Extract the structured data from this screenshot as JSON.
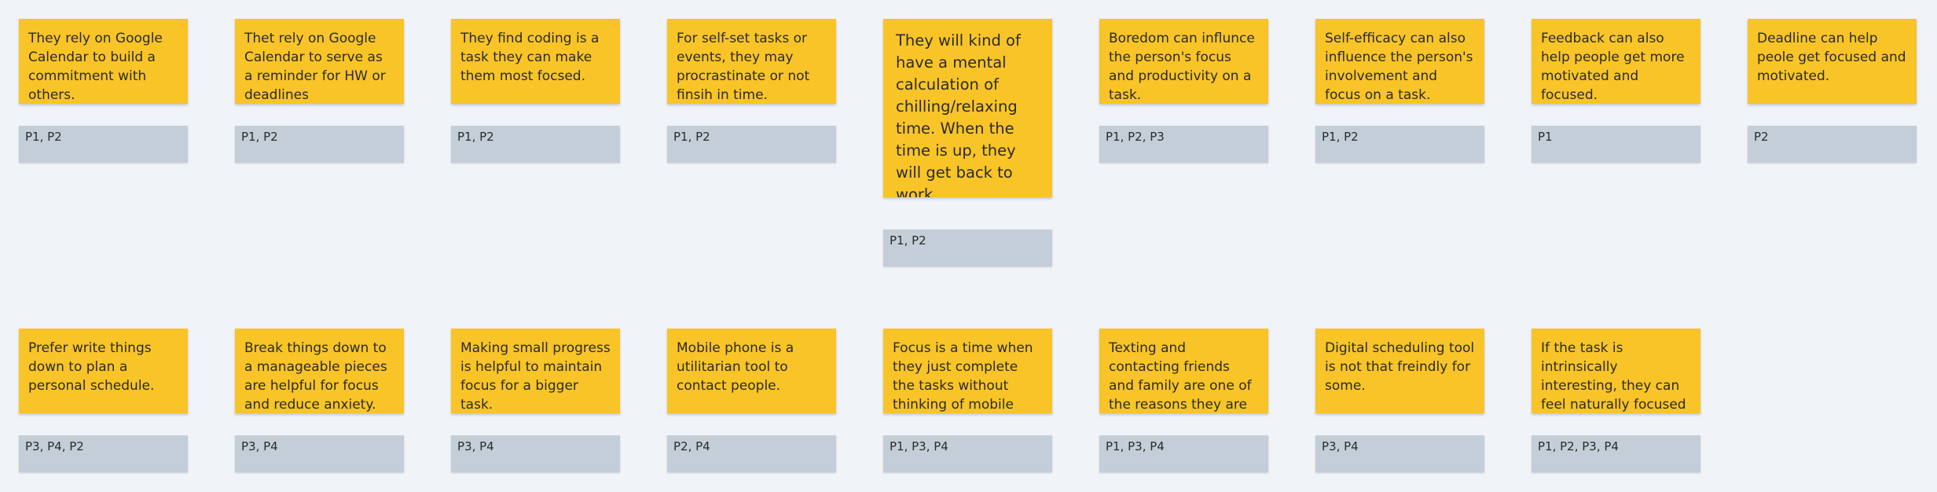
{
  "row1": [
    {
      "note": "They rely on Google Calendar to build a commitment with others.",
      "tag": "P1, P2"
    },
    {
      "note": "Thet rely on Google Calendar to serve as a reminder for HW or deadlines",
      "tag": "P1, P2"
    },
    {
      "note": "They find coding is a task they can make them most focsed.",
      "tag": "P1, P2"
    },
    {
      "note": "For self-set tasks or events, they may procrastinate or not finsih in time.",
      "tag": "P1, P2"
    },
    {
      "note": "They will kind of have a mental calculation of chilling/relaxing time. When the time is up, they will get back to work.",
      "tag": "P1, P2"
    },
    {
      "note": "Boredom can influnce the person's focus and productivity on a task.",
      "tag": "P1, P2, P3"
    },
    {
      "note": "Self-efficacy can also influence the person's involvement and focus on a task.",
      "tag": "P1, P2"
    },
    {
      "note": "Feedback can also help people get more motivated and focused.",
      "tag": "P1"
    },
    {
      "note": "Deadline can help peole get focused and motivated.",
      "tag": "P2"
    }
  ],
  "row2": [
    {
      "note": "Prefer write things down to plan a personal schedule.",
      "tag": "P3, P4, P2"
    },
    {
      "note": "Break things down to a manageable pieces are helpful for focus and reduce anxiety.",
      "tag": "P3, P4"
    },
    {
      "note": "Making small progress is helpful to maintain focus for a bigger task.",
      "tag": "P3, P4"
    },
    {
      "note": "Mobile phone is a utilitarian tool to contact people.",
      "tag": "P2, P4"
    },
    {
      "note": "Focus is a time when they just complete the tasks without thinking of mobile phones.",
      "tag": "P1, P3, P4"
    },
    {
      "note": "Texting and contacting friends and family are one of the reasons they are on their phones.",
      "tag": "P1, P3, P4"
    },
    {
      "note": "Digital scheduling tool is not that freindly for some.",
      "tag": "P3, P4"
    },
    {
      "note": "If the task is intrinsically interesting, they can feel naturally focused on that task.",
      "tag": "P1, P2, P3, P4"
    }
  ],
  "colors": {
    "background": "#f0f3f7",
    "sticky_note": "#f8c427",
    "participant_tag": "#c3ced8"
  }
}
